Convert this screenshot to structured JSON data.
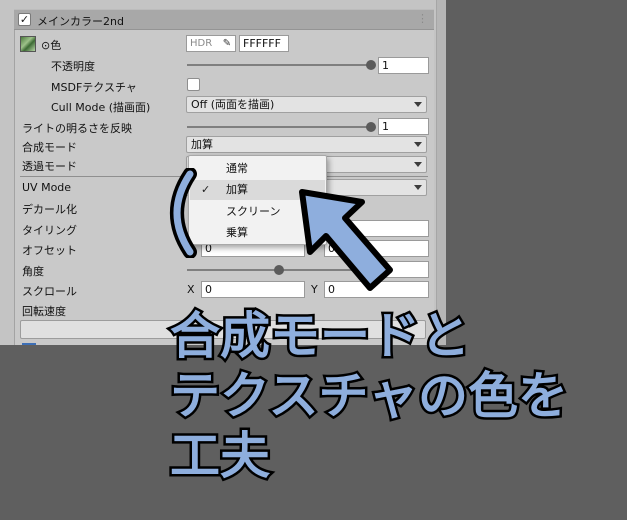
{
  "section": {
    "title": "メインカラー2nd",
    "checked": true
  },
  "rows": {
    "color": {
      "label": "⊙色",
      "hdr": "HDR",
      "hex": "FFFFFF"
    },
    "opacity": {
      "label": "不透明度",
      "value": "1",
      "level": 1.0
    },
    "msdf": {
      "label": "MSDFテクスチャ",
      "checked": false
    },
    "cull": {
      "label": "Cull Mode (描画面)",
      "value": "Off (両面を描画)"
    },
    "light": {
      "label": "ライトの明るさを反映",
      "value": "1",
      "level": 1.0
    },
    "blend": {
      "label": "合成モード",
      "value": "加算"
    },
    "transparency": {
      "label": "透過モード"
    },
    "uv_mode": {
      "label": "UV Mode"
    },
    "decal": {
      "label": "デカール化"
    },
    "tiling": {
      "label": "タイリング"
    },
    "offset": {
      "label": "オフセット",
      "x": "0",
      "y": "0"
    },
    "angle": {
      "label": "角度",
      "level": 0.5
    },
    "scroll": {
      "label": "スクロール",
      "x_label": "X",
      "x": "0",
      "y_label": "Y",
      "y": "0"
    },
    "rotation_speed": {
      "label": "回転速度"
    }
  },
  "popup": {
    "items": [
      {
        "label": "通常",
        "selected": false
      },
      {
        "label": "加算",
        "selected": true
      },
      {
        "label": "スクリーン",
        "selected": false
      },
      {
        "label": "乗算",
        "selected": false
      }
    ],
    "check_glyph": "✓"
  },
  "caption": {
    "line1": "合成モードと",
    "line2": "テクスチャの色を",
    "line3": "工夫"
  },
  "colors": {
    "annotation_blue": "#8eaedd",
    "annotation_outline": "#000000",
    "panel_bg": "#c4c4c4",
    "backdrop": "#5f5f5f"
  }
}
